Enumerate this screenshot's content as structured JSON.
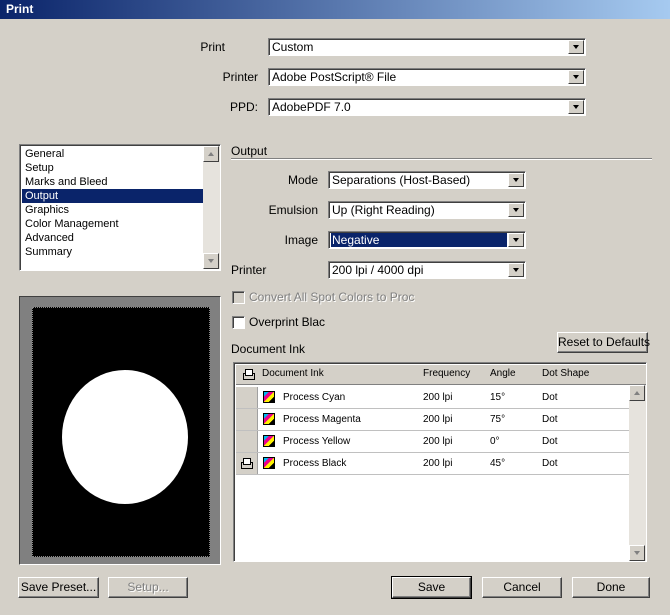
{
  "window": {
    "title": "Print"
  },
  "header": {
    "print_label": "Print",
    "print_value": "Custom",
    "printer_label": "Printer",
    "printer_value": "Adobe PostScript® File",
    "ppd_label": "PPD:",
    "ppd_value": "AdobePDF 7.0"
  },
  "sidebar": {
    "items": [
      "General",
      "Setup",
      "Marks and Bleed",
      "Output",
      "Graphics",
      "Color Management",
      "Advanced",
      "Summary"
    ],
    "selected": "Output"
  },
  "output": {
    "section_title": "Output",
    "mode_label": "Mode",
    "mode_value": "Separations (Host-Based)",
    "emulsion_label": "Emulsion",
    "emulsion_value": "Up (Right Reading)",
    "image_label": "Image",
    "image_value": "Negative",
    "printer_label": "Printer",
    "printer_value": "200 lpi / 4000 dpi",
    "convert_spot_label": "Convert All Spot Colors to Proc",
    "overprint_label": "Overprint Blac"
  },
  "document_ink": {
    "section_title": "Document Ink",
    "reset_label": "Reset to Defaults",
    "columns": [
      "Document Ink",
      "Frequency",
      "Angle",
      "Dot Shape"
    ],
    "rows": [
      {
        "name": "Process Cyan",
        "frequency": "200 lpi",
        "angle": "15°",
        "dot_shape": "Dot"
      },
      {
        "name": "Process Magenta",
        "frequency": "200 lpi",
        "angle": "75°",
        "dot_shape": "Dot"
      },
      {
        "name": "Process Yellow",
        "frequency": "200 lpi",
        "angle": "0°",
        "dot_shape": "Dot"
      },
      {
        "name": "Process Black",
        "frequency": "200 lpi",
        "angle": "45°",
        "dot_shape": "Dot"
      }
    ]
  },
  "footer": {
    "save_preset_label": "Save Preset...",
    "setup_label": "Setup...",
    "save_label": "Save",
    "cancel_label": "Cancel",
    "done_label": "Done"
  },
  "colors": {
    "title_bar": "#0a246a",
    "selection": "#0a246a",
    "dialog_bg": "#d4d0c8"
  },
  "icons": [
    "printer-icon",
    "process-ink-icon",
    "dropdown-arrow-icon",
    "scroll-up-icon",
    "scroll-down-icon"
  ]
}
